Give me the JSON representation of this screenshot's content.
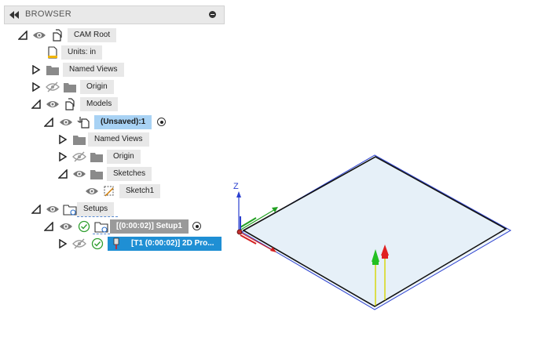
{
  "browser": {
    "title": "BROWSER",
    "items": [
      {
        "label": "CAM Root"
      },
      {
        "label": "Units: in"
      },
      {
        "label": "Named Views"
      },
      {
        "label": "Origin"
      },
      {
        "label": "Models"
      },
      {
        "label": "(Unsaved):1"
      },
      {
        "label": "Named Views"
      },
      {
        "label": "Origin"
      },
      {
        "label": "Sketches"
      },
      {
        "label": "Sketch1"
      },
      {
        "label": "Setups"
      },
      {
        "label": "[(0:00:02)] Setup1"
      },
      {
        "label": "[T1 (0:00:02)] 2D Pro..."
      }
    ]
  },
  "viewport": {
    "axis_z_label": "Z"
  },
  "colors": {
    "active_row": "#1f8fd4",
    "selected_component": "#a8d2f4",
    "setup_pill": "#9a9a9a",
    "check_green": "#2e9e2e",
    "axis_blue": "#2a3fcf",
    "axis_red": "#d42020",
    "axis_green": "#22a022"
  }
}
